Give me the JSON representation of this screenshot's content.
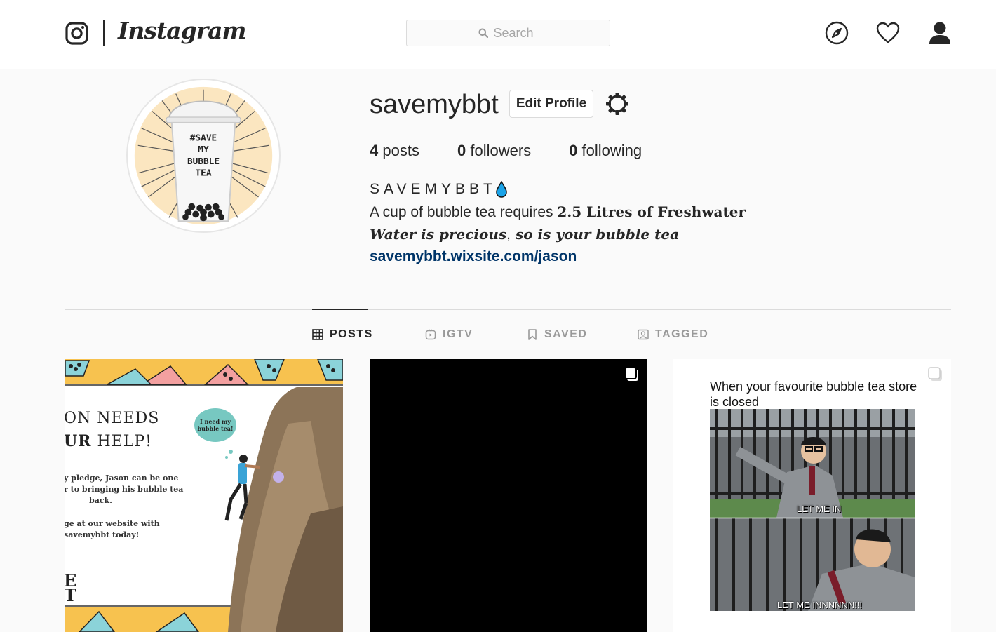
{
  "nav": {
    "wordmark": "Instagram",
    "search_placeholder": "Search"
  },
  "profile": {
    "username": "savemybbt",
    "edit_profile_label": "Edit Profile",
    "stats": {
      "posts_count": "4",
      "posts_label": "posts",
      "followers_count": "0",
      "followers_label": "followers",
      "following_count": "0",
      "following_label": "following"
    },
    "bio": {
      "name": "SAVEMYBBT",
      "line1_prefix": "A cup of bubble tea requires ",
      "line1_bold": "2.5 Litres of Freshwater",
      "line2_italic": "Water is precious",
      "line2_rest": ", so is your bubble tea",
      "link": "savemybbt.wixsite.com/jason"
    },
    "avatar_text": [
      "#SAVE",
      "MY",
      "BUBBLE",
      "TEA"
    ]
  },
  "tabs": [
    {
      "label": "POSTS",
      "icon": "grid-icon",
      "active": true
    },
    {
      "label": "IGTV",
      "icon": "igtv-icon",
      "active": false
    },
    {
      "label": "SAVED",
      "icon": "bookmark-icon",
      "active": false
    },
    {
      "label": "TAGGED",
      "icon": "tagged-icon",
      "active": false
    }
  ],
  "posts": [
    {
      "headline_1": "ON NEEDS",
      "headline_2_bold": "UR",
      "headline_2_rest": " HELP!",
      "speech": "I need my bubble tea!",
      "body_1": "y pledge, Jason can be one",
      "body_2": "r to bringing his bubble tea",
      "body_3": "back.",
      "body_4": "ge at our website with",
      "body_5": "savemybbt today!",
      "footer_1": "E",
      "footer_2": "T"
    },
    {
      "type": "video-black"
    },
    {
      "caption": "When your favourite bubble tea store is closed",
      "sub_top": "LET ME IN",
      "sub_bottom": "LET ME INNNNNN!!!"
    }
  ],
  "colors": {
    "link": "#003569",
    "border": "#dbdbdb",
    "drop": "#1aa3e8"
  }
}
